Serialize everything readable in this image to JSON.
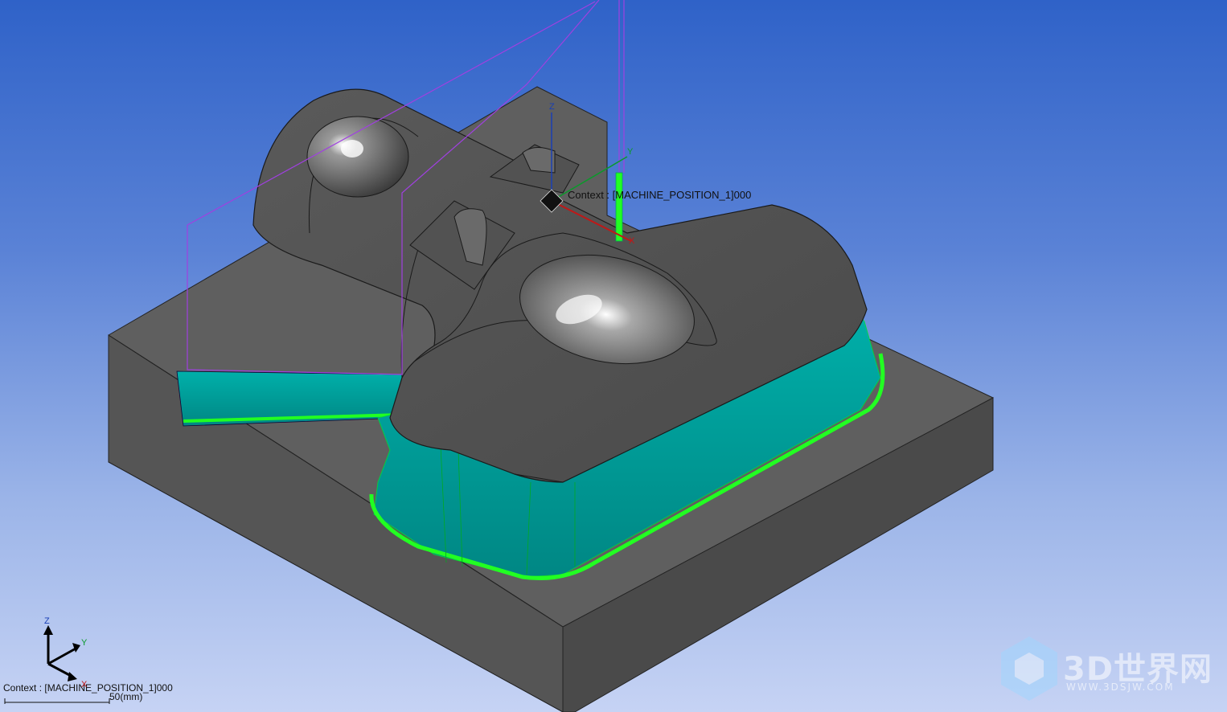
{
  "viewport": {
    "context_main": "Context : [MACHINE_POSITION_1]000",
    "context_corner": "Context : [MACHINE_POSITION_1]000",
    "scale_label": "50(mm)"
  },
  "axes": {
    "z": "Z",
    "y": "Y",
    "x": "X"
  },
  "watermark": {
    "title": "3D世界网",
    "url": "WWW.3DSJW.COM"
  },
  "colors": {
    "background_top": "#2f62c8",
    "background_bottom": "#c6d3f4",
    "stock_gray": "#5f5f5f",
    "machined_teal": "#009a96",
    "toolpath_green": "#22ff22",
    "toolpath_purple": "#a040e0"
  }
}
